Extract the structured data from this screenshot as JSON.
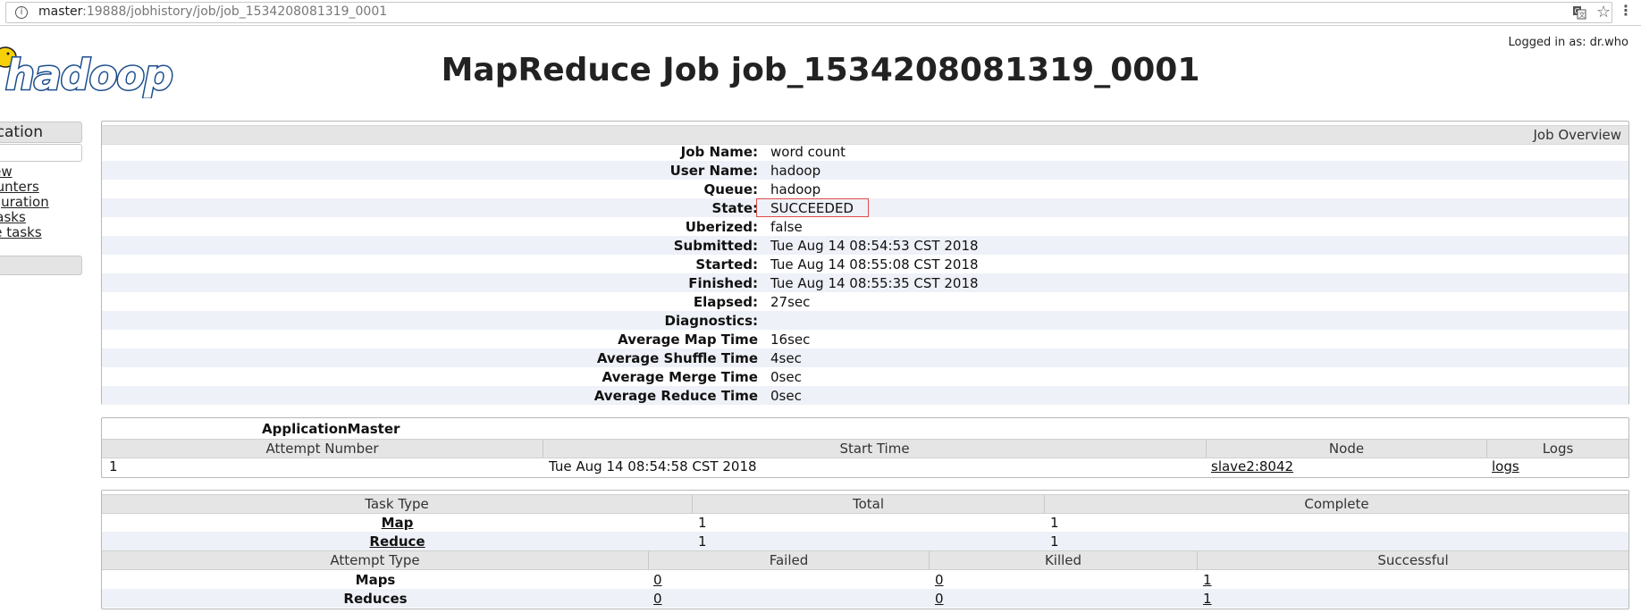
{
  "browser": {
    "url_host": "master",
    "url_path": ":19888/jobhistory/job/job_1534208081319_0001"
  },
  "header": {
    "logo_text": "hadoop",
    "title": "MapReduce Job job_1534208081319_0001",
    "logged_in": "Logged in as: dr.who"
  },
  "sidebar": {
    "heading": "Application",
    "links": [
      "Overview",
      "Counters",
      "Configuration",
      "Map tasks",
      "Reduce tasks"
    ]
  },
  "overview": {
    "heading": "Job Overview",
    "rows": [
      {
        "key": "Job Name:",
        "value": "word count"
      },
      {
        "key": "User Name:",
        "value": "hadoop"
      },
      {
        "key": "Queue:",
        "value": "hadoop"
      },
      {
        "key": "State:",
        "value": "SUCCEEDED"
      },
      {
        "key": "Uberized:",
        "value": "false"
      },
      {
        "key": "Submitted:",
        "value": "Tue Aug 14 08:54:53 CST 2018"
      },
      {
        "key": "Started:",
        "value": "Tue Aug 14 08:55:08 CST 2018"
      },
      {
        "key": "Finished:",
        "value": "Tue Aug 14 08:55:35 CST 2018"
      },
      {
        "key": "Elapsed:",
        "value": "27sec"
      },
      {
        "key": "Diagnostics:",
        "value": ""
      },
      {
        "key": "Average Map Time",
        "value": "16sec"
      },
      {
        "key": "Average Shuffle Time",
        "value": "4sec"
      },
      {
        "key": "Average Merge Time",
        "value": "0sec"
      },
      {
        "key": "Average Reduce Time",
        "value": "0sec"
      }
    ]
  },
  "app_master": {
    "title": "ApplicationMaster",
    "columns": [
      "Attempt Number",
      "Start Time",
      "Node",
      "Logs"
    ],
    "row": {
      "attempt": "1",
      "start_time": "Tue Aug 14 08:54:58 CST 2018",
      "node": "slave2:8042",
      "logs": "logs"
    }
  },
  "tasks": {
    "columns": [
      "Task Type",
      "Total",
      "Complete"
    ],
    "rows": [
      {
        "type": "Map",
        "total": "1",
        "complete": "1"
      },
      {
        "type": "Reduce",
        "total": "1",
        "complete": "1"
      }
    ],
    "attempt_columns": [
      "Attempt Type",
      "Failed",
      "Killed",
      "Successful"
    ],
    "attempt_rows": [
      {
        "type": "Maps",
        "failed": "0",
        "killed": "0",
        "successful": "1"
      },
      {
        "type": "Reduces",
        "failed": "0",
        "killed": "0",
        "successful": "1"
      }
    ]
  },
  "colors": {
    "header_bg": "#e5e5e5",
    "alt_row": "#eef1f8",
    "state_highlight": "#e04a4a",
    "logo_blue": "#1c4d8c",
    "logo_yellow": "#f6d10a"
  }
}
